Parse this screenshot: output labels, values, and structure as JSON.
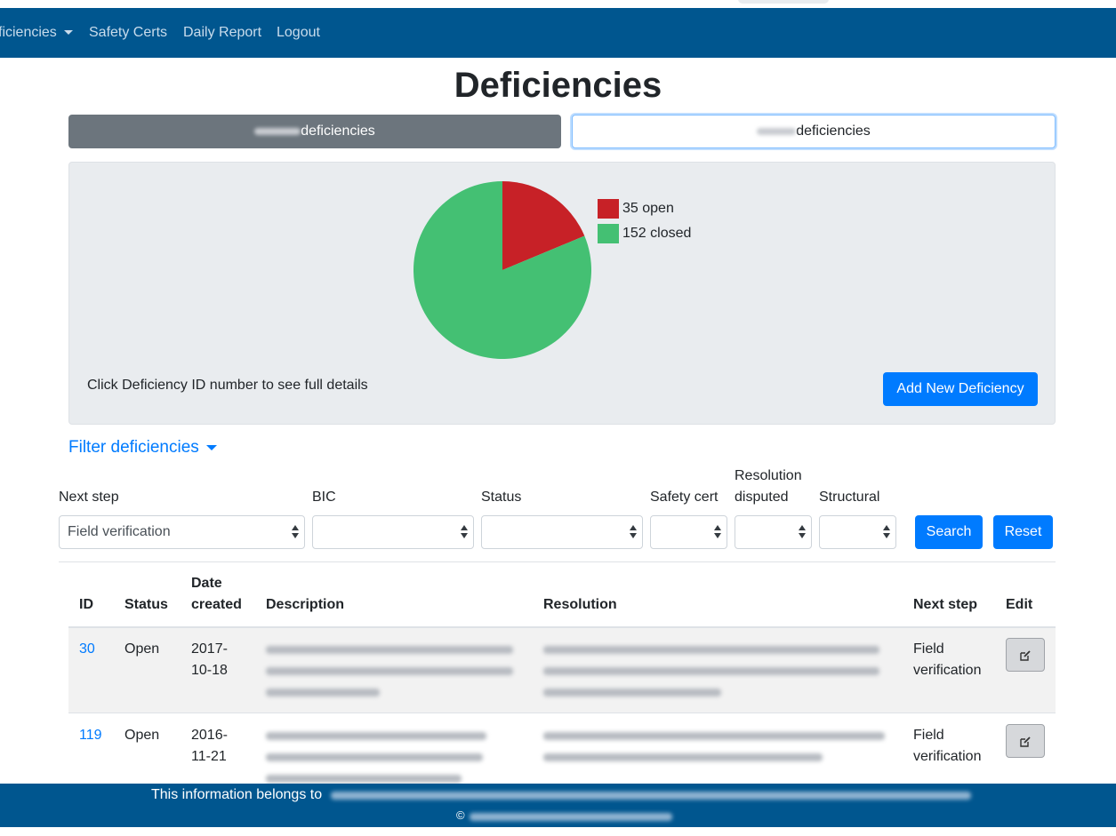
{
  "navbar": {
    "items": [
      {
        "label": "ficiencies",
        "dropdown": true
      },
      {
        "label": "Safety Certs"
      },
      {
        "label": "Daily Report"
      },
      {
        "label": "Logout"
      }
    ]
  },
  "page": {
    "title": "Deficiencies"
  },
  "tabs": [
    {
      "label": "deficiencies",
      "active": true
    },
    {
      "label": "deficiencies",
      "active": false
    }
  ],
  "summary": {
    "legend": [
      {
        "label": "35 open",
        "color": "#c72127"
      },
      {
        "label": "152 closed",
        "color": "#44c073"
      }
    ],
    "hint": "Click Deficiency ID number to see full details",
    "add_button": "Add New Deficiency"
  },
  "chart_data": {
    "type": "pie",
    "slices": [
      {
        "label": "open",
        "value": 35,
        "color": "#c72127"
      },
      {
        "label": "closed",
        "value": 152,
        "color": "#44c073"
      }
    ]
  },
  "filters": {
    "toggle": "Filter deficiencies",
    "next_step_label": "Next step",
    "next_step_value": "Field verification",
    "bic_label": "BIC",
    "status_label": "Status",
    "safety_cert_label": "Safety cert",
    "resolution_disputed_label_1": "Resolution",
    "resolution_disputed_label_2": "disputed",
    "structural_label": "Structural",
    "search_button": "Search",
    "reset_button": "Reset"
  },
  "table": {
    "headers": {
      "id": "ID",
      "status": "Status",
      "date_created_1": "Date",
      "date_created_2": "created",
      "description": "Description",
      "resolution": "Resolution",
      "next_step": "Next step",
      "edit": "Edit"
    },
    "rows": [
      {
        "id": "30",
        "status": "Open",
        "date_1": "2017-",
        "date_2": "10-18",
        "next_step_1": "Field",
        "next_step_2": "verification"
      },
      {
        "id": "119",
        "status": "Open",
        "date_1": "2016-",
        "date_2": "11-21",
        "next_step_1": "Field",
        "next_step_2": "verification"
      }
    ]
  },
  "footer": {
    "text": "This information belongs to",
    "copyright": "©"
  }
}
